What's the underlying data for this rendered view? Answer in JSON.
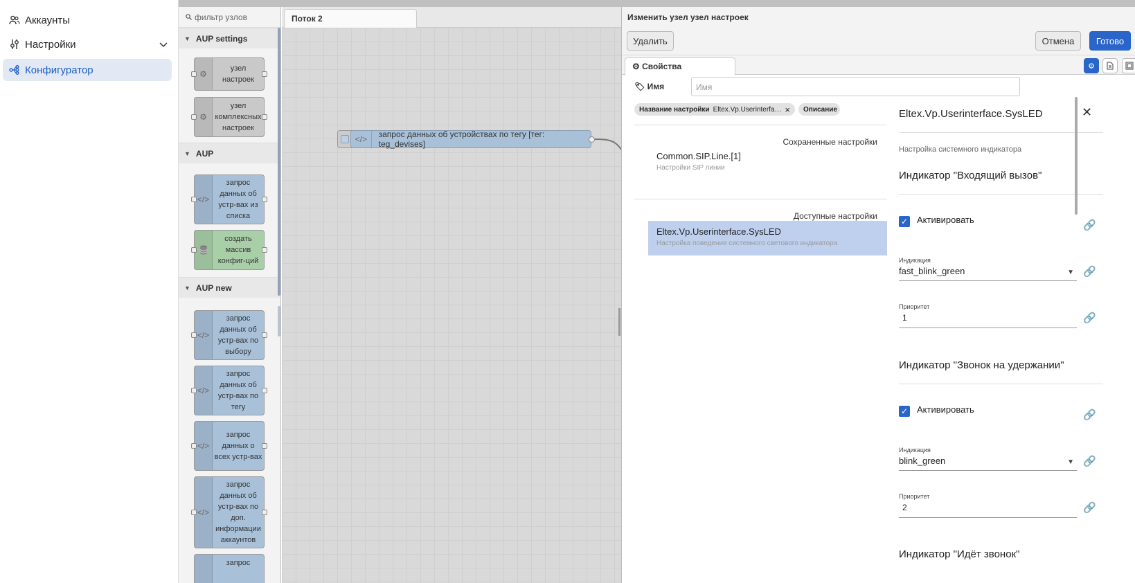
{
  "nav": {
    "items": [
      {
        "label": "Аккаунты",
        "icon": "users-icon"
      },
      {
        "label": "Настройки",
        "icon": "sliders-icon"
      },
      {
        "label": "Конфигуратор",
        "icon": "network-icon"
      }
    ]
  },
  "palette": {
    "search_placeholder": "фильтр узлов",
    "categories": [
      {
        "label": "AUP settings",
        "nodes": [
          "узел настроек",
          "узел комплексных настроек"
        ]
      },
      {
        "label": "AUP",
        "nodes": [
          "запрос данных об устр-вах из списка",
          "создать массив конфиг-ций"
        ]
      },
      {
        "label": "AUP new",
        "nodes": [
          "запрос данных об устр-вах по выбору",
          "запрос данных об устр-вах по тегу",
          "запрос данных о всех устр-вах",
          "запрос данных об устр-вах по доп. информации аккаунтов",
          "запрос"
        ]
      }
    ]
  },
  "workspace": {
    "tab": "Поток 2",
    "node_label": "запрос данных об устройствах по тегу [тег: teg_devises]"
  },
  "editor": {
    "title": "Изменить узел узел настроек",
    "delete_label": "Удалить",
    "cancel_label": "Отмена",
    "done_label": "Готово",
    "tab_label": "Свойства",
    "name_label": "Имя",
    "name_placeholder": "Имя",
    "chip_setting_name": "Название настройки",
    "chip_setting_value": "Eltex.Vp.Userinterfa…",
    "chip_description": "Описание",
    "saved_header": "Сохраненные настройки",
    "saved_items": [
      {
        "title": "Common.SIP.Line.[1]",
        "subtitle": "Настройки SIP линии"
      }
    ],
    "available_header": "Доступные настройки",
    "available_items": [
      {
        "title": "Eltex.Vp.Userinterface.SysLED",
        "subtitle": "Настройка поведения системного светового индикатора"
      }
    ],
    "detail": {
      "title": "Eltex.Vp.Userinterface.SysLED",
      "subtitle": "Настройка системного индикатора",
      "sections": [
        {
          "heading": "Индикатор \"Входящий вызов\"",
          "activate": "Активировать",
          "indication_label": "Индикация",
          "indication": "fast_blink_green",
          "priority_label": "Приоритет",
          "priority": "1"
        },
        {
          "heading": "Индикатор \"Звонок на удержании\"",
          "activate": "Активировать",
          "indication_label": "Индикация",
          "indication": "blink_green",
          "priority_label": "Приоритет",
          "priority": "2"
        },
        {
          "heading": "Индикатор \"Идёт звонок\""
        }
      ]
    }
  }
}
